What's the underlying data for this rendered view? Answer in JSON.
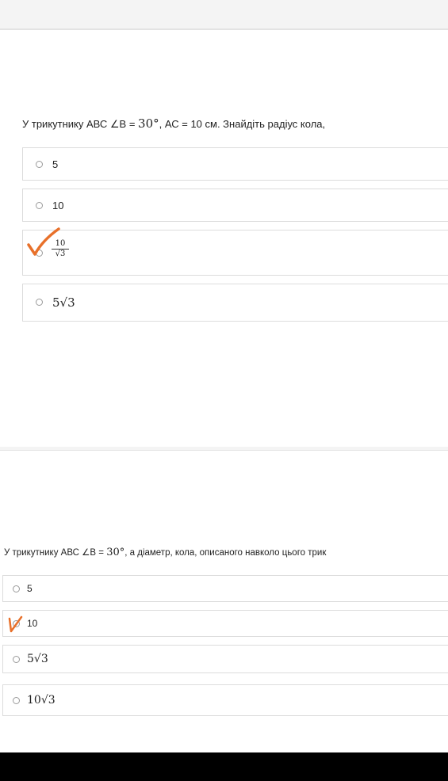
{
  "question1": {
    "prefix": "У трикутнику АВС ∠В = ",
    "angle": "30°",
    "suffix": ", АС = 10 см. Знайдіть радіус кола,",
    "options": [
      {
        "label": "5"
      },
      {
        "label": "10"
      },
      {
        "numerator": "10",
        "denominator": "√3"
      },
      {
        "label": "5√3"
      }
    ],
    "marked_option": 3,
    "mark_color": "#e8702a"
  },
  "question2": {
    "prefix": "У трикутнику АВС ∠В = ",
    "angle": "30°",
    "suffix": ", а діаметр, кола, описаного навколо цього трик",
    "options": [
      {
        "label": "5"
      },
      {
        "label": "10"
      },
      {
        "label": "5√3"
      },
      {
        "label": "10√3"
      }
    ],
    "marked_option": 2,
    "mark_color": "#e8702a"
  }
}
